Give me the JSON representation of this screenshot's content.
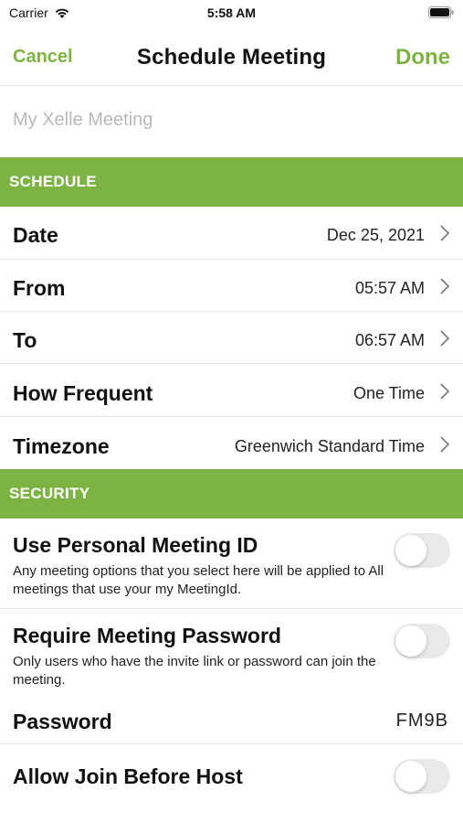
{
  "status_bar": {
    "carrier": "Carrier",
    "time": "5:58 AM"
  },
  "nav": {
    "cancel_label": "Cancel",
    "title": "Schedule Meeting",
    "done_label": "Done"
  },
  "meeting_name": {
    "value": "",
    "placeholder": "My Xelle Meeting"
  },
  "schedule": {
    "header": "SCHEDULE",
    "rows": [
      {
        "label": "Date",
        "value": "Dec  25, 2021"
      },
      {
        "label": "From",
        "value": "05:57 AM"
      },
      {
        "label": "To",
        "value": "06:57 AM"
      },
      {
        "label": "How Frequent",
        "value": "One Time"
      },
      {
        "label": "Timezone",
        "value": "Greenwich Standard Time"
      }
    ]
  },
  "security": {
    "header": "SECURITY",
    "personal_id": {
      "title": "Use Personal Meeting ID",
      "description": "Any meeting options that you select here will be applied to All meetings that use your my MeetingId.",
      "enabled": false
    },
    "require_password": {
      "title": "Require Meeting Password",
      "description": "Only users who have the invite link or password can join the meeting.",
      "enabled": false
    },
    "password": {
      "label": "Password",
      "value": "FM9B"
    },
    "join_before_host": {
      "title": "Allow Join Before Host",
      "enabled": false
    }
  },
  "colors": {
    "accent": "#7cb342",
    "toggle_off": "#e9e9ea"
  },
  "icons": [
    "wifi-icon",
    "battery-icon",
    "chevron-right-icon"
  ]
}
